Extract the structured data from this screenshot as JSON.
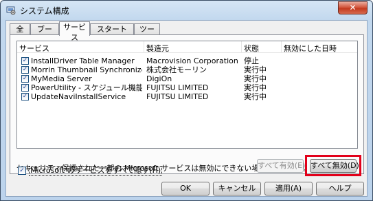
{
  "window": {
    "title": "システム構成",
    "close_symbol": "✕",
    "icon": "system-config-icon"
  },
  "tabs": [
    {
      "label": "全般",
      "active": false
    },
    {
      "label": "ブート",
      "active": false
    },
    {
      "label": "サービス",
      "active": true
    },
    {
      "label": "スタートアップ",
      "active": false
    },
    {
      "label": "ツール",
      "active": false
    }
  ],
  "services": {
    "columns": {
      "service": "サービス",
      "manufacturer": "製造元",
      "status": "状態",
      "disabled_date": "無効にした日時"
    },
    "rows": [
      {
        "checked": true,
        "service": "InstallDriver Table Manager",
        "manufacturer": "Macrovision Corporation",
        "status": "停止",
        "disabled_date": ""
      },
      {
        "checked": true,
        "service": "Morrin Thumbnail Synchronized Servic...",
        "manufacturer": "株式会社モーリン",
        "status": "実行中",
        "disabled_date": ""
      },
      {
        "checked": true,
        "service": "MyMedia Server",
        "manufacturer": "DigiOn",
        "status": "実行中",
        "disabled_date": ""
      },
      {
        "checked": true,
        "service": "PowerUtility - スケジュール機能",
        "manufacturer": "FUJITSU LIMITED",
        "status": "実行中",
        "disabled_date": ""
      },
      {
        "checked": true,
        "service": "UpdateNaviInstallService",
        "manufacturer": "FUJITSU LIMITED",
        "status": "実行中",
        "disabled_date": ""
      }
    ],
    "check_mark": "✓",
    "notice": "セキュリティ保護された一部の Microsoft サービスは無効にできない場合があります。",
    "enable_all": "すべて有効(E)",
    "disable_all": "すべて無効(D)",
    "hide_ms_label": "Microsoft のサービスをすべて隠す(H)",
    "hide_ms_checked": true
  },
  "footer": {
    "ok": "OK",
    "cancel": "キャンセル",
    "apply": "適用(A)",
    "help": "ヘルプ"
  },
  "colors": {
    "highlight": "#e2001a"
  }
}
